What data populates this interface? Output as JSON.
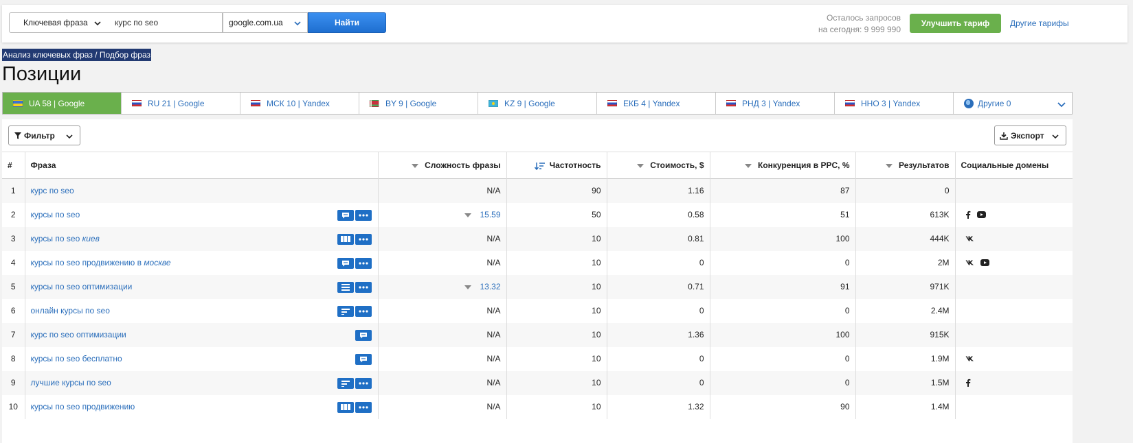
{
  "search": {
    "type_label": "Ключевая фраза",
    "query": "курс по seo",
    "domain": "google.com.ua",
    "find_label": "Найти",
    "remaining_line1": "Осталось запросов",
    "remaining_line2": "на сегодня: 9 999 990",
    "upgrade_label": "Улучшить тариф",
    "other_tariffs_label": "Другие тарифы"
  },
  "breadcrumb": "Анализ ключевых фраз / Подбор фраз",
  "page_title": "Позиции",
  "tabs": [
    {
      "label": "UA 58 | Google",
      "flag": "ua",
      "active": true
    },
    {
      "label": "RU 21 | Google",
      "flag": "ru"
    },
    {
      "label": "МСК 10 | Yandex",
      "flag": "ru"
    },
    {
      "label": "BY 9 | Google",
      "flag": "by"
    },
    {
      "label": "KZ 9 | Google",
      "flag": "kz"
    },
    {
      "label": "ЕКБ 4 | Yandex",
      "flag": "ru"
    },
    {
      "label": "РНД 3 | Yandex",
      "flag": "ru"
    },
    {
      "label": "ННО 3 | Yandex",
      "flag": "ru"
    },
    {
      "label": "Другие 0",
      "flag": "globe"
    }
  ],
  "toolbar": {
    "filter_label": "Фильтр",
    "export_label": "Экспорт"
  },
  "table": {
    "headers": {
      "num": "#",
      "phrase": "Фраза",
      "difficulty": "Сложность фразы",
      "frequency": "Частотность",
      "cost": "Стоимость, $",
      "competition": "Конкуренция в PPC, %",
      "results": "Результатов",
      "social": "Социальные домены"
    },
    "rows": [
      {
        "n": "1",
        "base": "курс по seo",
        "italic": "",
        "serp": [],
        "difficulty": "N/A",
        "frequency": "90",
        "cost": "1.16",
        "competition": "87",
        "results": "0",
        "social": []
      },
      {
        "n": "2",
        "base": "курсы по seo",
        "italic": "",
        "serp": [
          "chat",
          "more"
        ],
        "difficulty": "15.59",
        "frequency": "50",
        "cost": "0.58",
        "competition": "51",
        "results": "613K",
        "social": [
          "facebook",
          "youtube"
        ]
      },
      {
        "n": "3",
        "base": "курсы по seo ",
        "italic": "киев",
        "serp": [
          "columns",
          "more"
        ],
        "difficulty": "N/A",
        "frequency": "10",
        "cost": "0.81",
        "competition": "100",
        "results": "444K",
        "social": [
          "vk"
        ]
      },
      {
        "n": "4",
        "base": "курсы по seo продвижению в ",
        "italic": "москве",
        "serp": [
          "chat",
          "more"
        ],
        "difficulty": "N/A",
        "frequency": "10",
        "cost": "0",
        "competition": "0",
        "results": "2M",
        "social": [
          "vk",
          "youtube"
        ]
      },
      {
        "n": "5",
        "base": "курсы по seo оптимизации",
        "italic": "",
        "serp": [
          "list",
          "more"
        ],
        "difficulty": "13.32",
        "frequency": "10",
        "cost": "0.71",
        "competition": "91",
        "results": "971K",
        "social": []
      },
      {
        "n": "6",
        "base": "онлайн курсы по seo",
        "italic": "",
        "serp": [
          "lines",
          "more"
        ],
        "difficulty": "N/A",
        "frequency": "10",
        "cost": "0",
        "competition": "0",
        "results": "2.4M",
        "social": []
      },
      {
        "n": "7",
        "base": "курс по seo оптимизации",
        "italic": "",
        "serp": [
          "chat"
        ],
        "difficulty": "N/A",
        "frequency": "10",
        "cost": "1.36",
        "competition": "100",
        "results": "915K",
        "social": []
      },
      {
        "n": "8",
        "base": "курсы по seo бесплатно",
        "italic": "",
        "serp": [
          "chat"
        ],
        "difficulty": "N/A",
        "frequency": "10",
        "cost": "0",
        "competition": "0",
        "results": "1.9M",
        "social": [
          "vk"
        ]
      },
      {
        "n": "9",
        "base": "лучшие курсы по seo",
        "italic": "",
        "serp": [
          "lines",
          "more"
        ],
        "difficulty": "N/A",
        "frequency": "10",
        "cost": "0",
        "competition": "0",
        "results": "1.5M",
        "social": [
          "facebook"
        ]
      },
      {
        "n": "10",
        "base": "курсы по seo продвижению",
        "italic": "",
        "serp": [
          "columns",
          "more"
        ],
        "difficulty": "N/A",
        "frequency": "10",
        "cost": "1.32",
        "competition": "90",
        "results": "1.4M",
        "social": []
      }
    ]
  },
  "colors": {
    "accent_blue": "#2a6ebb",
    "button_blue": "#1f6fc5",
    "active_green": "#6ab04c",
    "breadcrumb_bg": "#223a72"
  }
}
